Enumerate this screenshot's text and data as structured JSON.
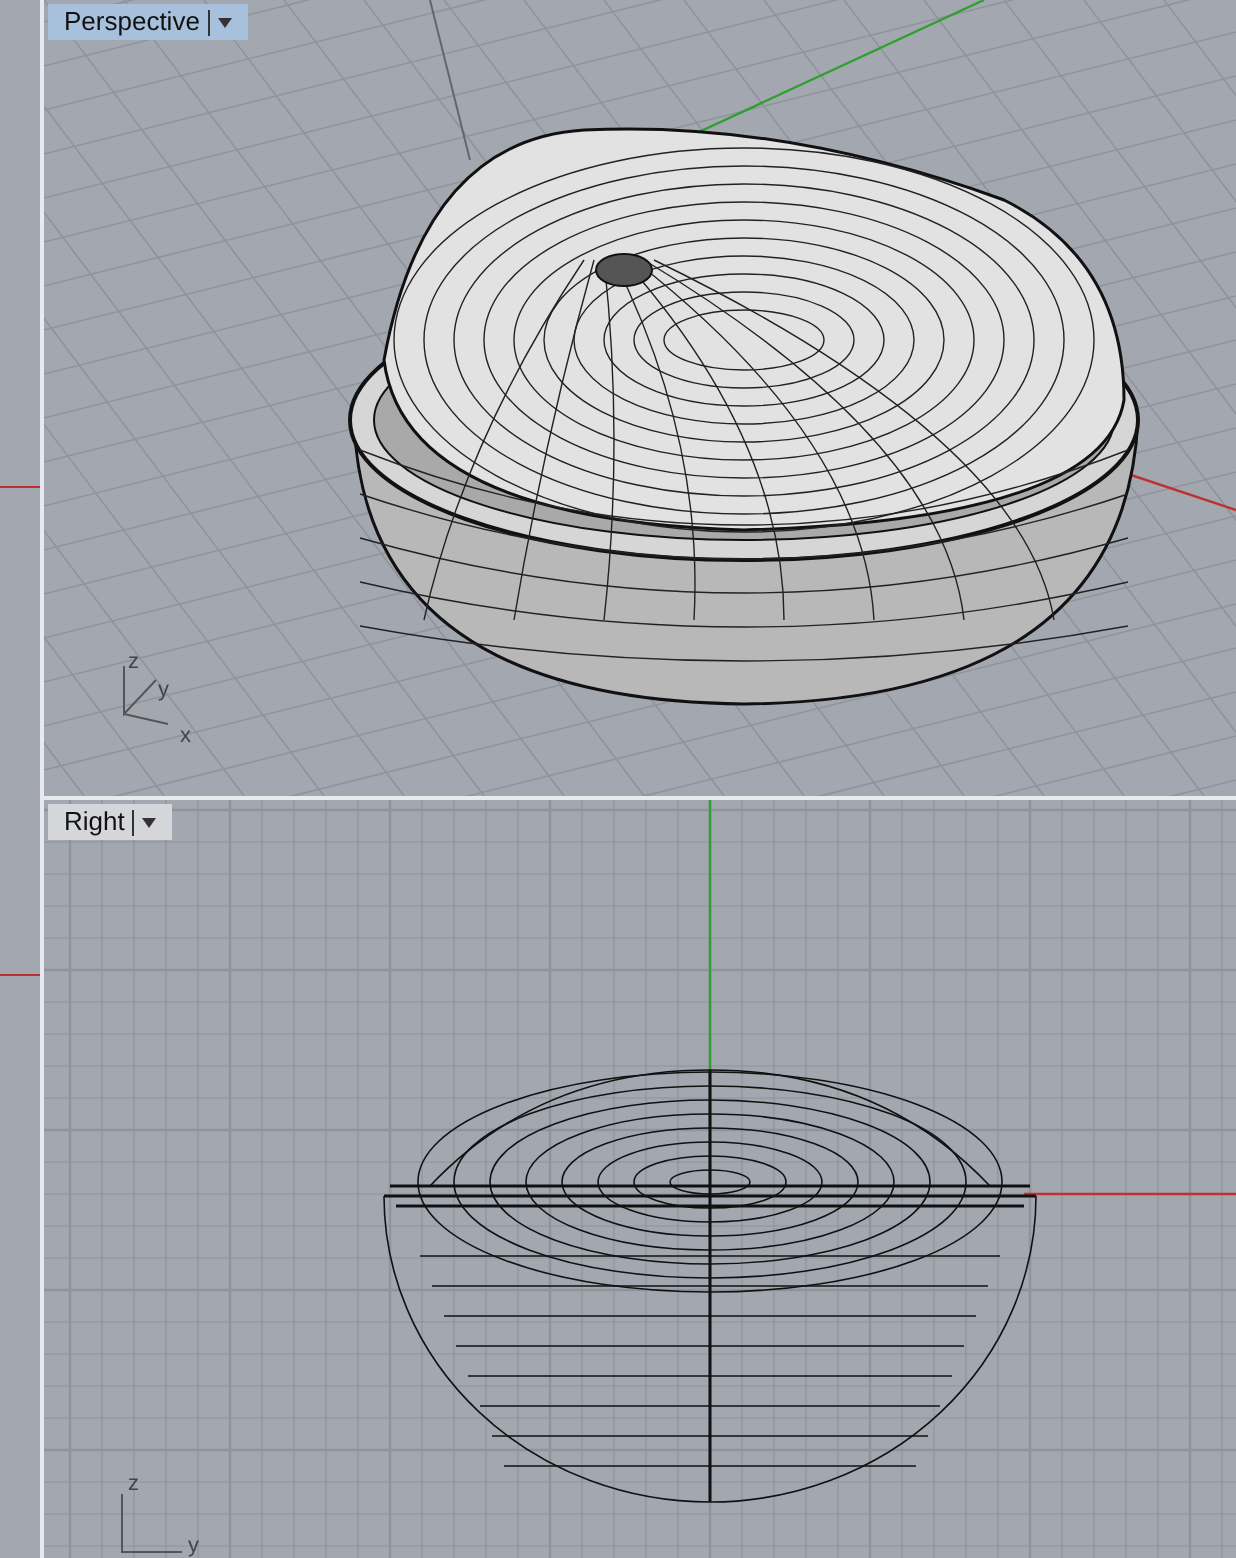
{
  "viewports": [
    {
      "kind": "perspective",
      "title": "Perspective",
      "selected": true,
      "axes": [
        "z",
        "y",
        "x"
      ]
    },
    {
      "kind": "right",
      "title": "Right",
      "selected": false,
      "axes": [
        "z",
        "y"
      ]
    }
  ]
}
